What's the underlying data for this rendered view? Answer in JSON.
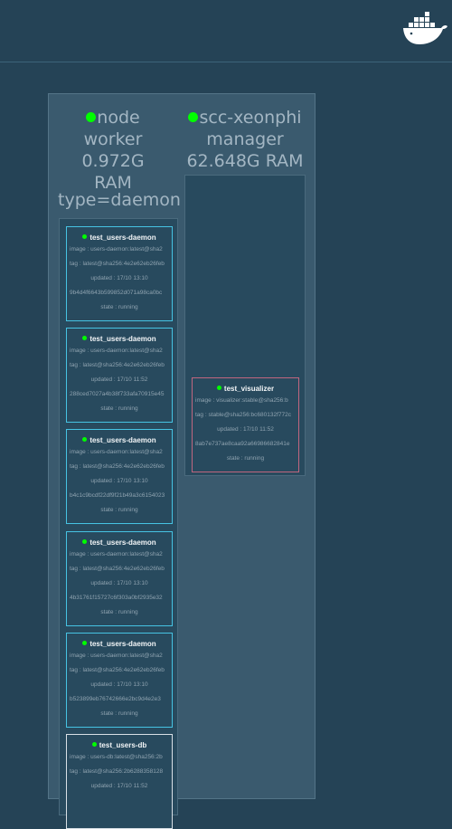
{
  "nodes": [
    {
      "name": "node",
      "role": "worker",
      "ram": "0.972G RAM"
    },
    {
      "name": "scc-xeonphi",
      "role": "manager",
      "ram": "62.648G RAM"
    }
  ],
  "worker_label": "type=daemon",
  "worker_tasks": [
    {
      "name": "test_users-daemon",
      "image": "image : users-daemon:latest@sha2",
      "tag": "tag : latest@sha256:4e2e62eb26feb",
      "updated": "updated : 17/10 13:10",
      "id": "9b4d4f6643b599852d071a98ca0bc",
      "state": "state : running"
    },
    {
      "name": "test_users-daemon",
      "image": "image : users-daemon:latest@sha2",
      "tag": "tag : latest@sha256:4e2e62eb26feb",
      "updated": "updated : 17/10 11:52",
      "id": "288ced7027a4b38f733afa70915e45",
      "state": "state : running"
    },
    {
      "name": "test_users-daemon",
      "image": "image : users-daemon:latest@sha2",
      "tag": "tag : latest@sha256:4e2e62eb26feb",
      "updated": "updated : 17/10 13:10",
      "id": "b4c1c9bcdf22df9f21b49a3c6154023",
      "state": "state : running"
    },
    {
      "name": "test_users-daemon",
      "image": "image : users-daemon:latest@sha2",
      "tag": "tag : latest@sha256:4e2e62eb26feb",
      "updated": "updated : 17/10 13:10",
      "id": "4b31761f15727c6f303a0bf2935e32",
      "state": "state : running"
    },
    {
      "name": "test_users-daemon",
      "image": "image : users-daemon:latest@sha2",
      "tag": "tag : latest@sha256:4e2e62eb26feb",
      "updated": "updated : 17/10 13:10",
      "id": "b523899eb76742666e2bc9d4e2e3",
      "state": "state : running"
    },
    {
      "name": "test_users-db",
      "image": "image : users-db:latest@sha256:2b",
      "tag": "tag : latest@sha256:2b6288358128",
      "updated": "updated : 17/10 11:52",
      "id": "",
      "state": ""
    }
  ],
  "manager_tasks": [
    {
      "name": "test_visualizer",
      "image": "image : visualizer:stable@sha256:b",
      "tag": "tag : stable@sha256:bc680132f772c",
      "updated": "updated : 17/10 11:52",
      "id": "8ab7e737ae8caa92a66986682841e",
      "state": "state : running"
    }
  ],
  "colors": {
    "background": "#254356",
    "running_dot": "#00ff00",
    "daemon_border": "#46c3e3",
    "db_border": "#d8e0e6",
    "visualizer_border": "#c0667f"
  },
  "icons": {
    "logo": "docker-whale-logo"
  }
}
